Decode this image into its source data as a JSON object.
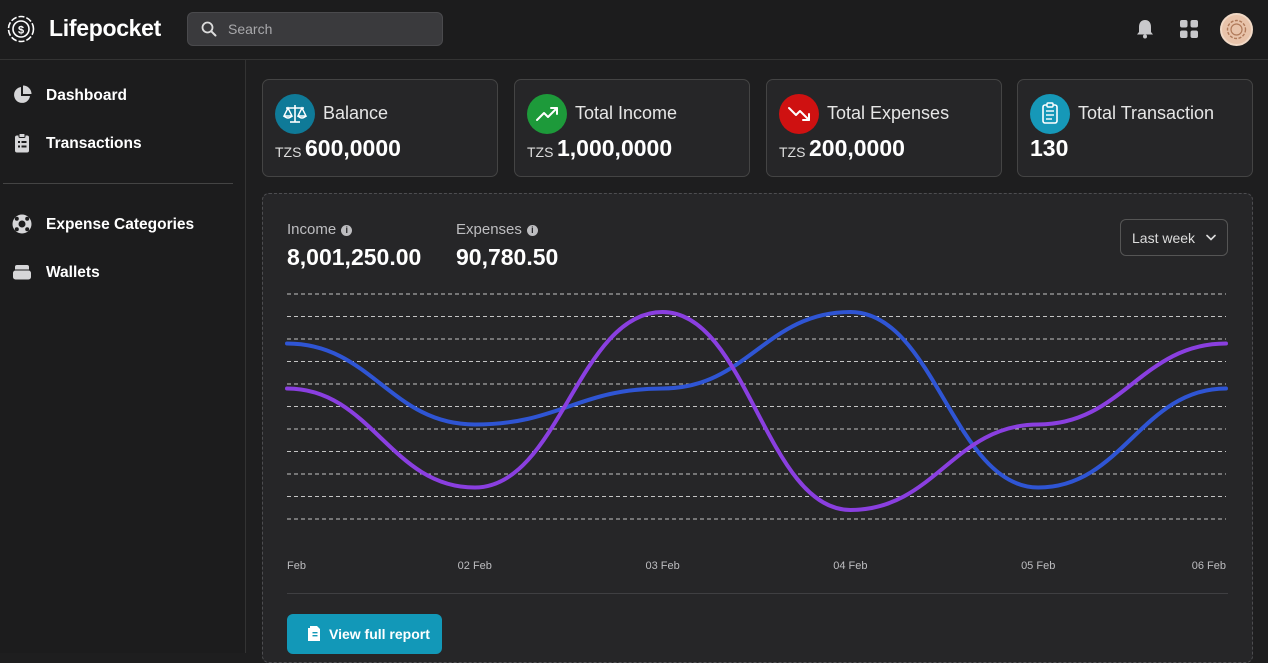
{
  "app": {
    "title": "Lifepocket"
  },
  "search": {
    "placeholder": "Search"
  },
  "sidebar": {
    "items": [
      {
        "label": "Dashboard",
        "icon": "pie-chart-icon"
      },
      {
        "label": "Transactions",
        "icon": "clipboard-list-icon"
      },
      {
        "label": "Expense Categories",
        "icon": "life-ring-icon"
      },
      {
        "label": "Wallets",
        "icon": "wallet-icon"
      }
    ]
  },
  "cards": [
    {
      "title": "Balance",
      "currency": "TZS",
      "value": "600,0000",
      "icon": "scale-icon",
      "color": "#0f7a98"
    },
    {
      "title": "Total Income",
      "currency": "TZS",
      "value": "1,000,0000",
      "icon": "trending-up-icon",
      "color": "#1d9a3a"
    },
    {
      "title": "Total Expenses",
      "currency": "TZS",
      "value": "200,0000",
      "icon": "trending-down-icon",
      "color": "#cf1111"
    },
    {
      "title": "Total Transaction",
      "currency": "",
      "value": "130",
      "icon": "clipboard-icon",
      "color": "#1698b8"
    }
  ],
  "summary": {
    "income_label": "Income",
    "income_value": "8,001,250.00",
    "expenses_label": "Expenses",
    "expenses_value": "90,780.50",
    "range": "Last week"
  },
  "chart_data": {
    "type": "line",
    "x": [
      "Feb",
      "02 Feb",
      "03 Feb",
      "04 Feb",
      "05 Feb",
      "06 Feb"
    ],
    "series": [
      {
        "color": "#2f55d4",
        "values": [
          0.78,
          0.42,
          0.58,
          0.92,
          0.14,
          0.58
        ]
      },
      {
        "color": "#8a3fe0",
        "values": [
          0.58,
          0.14,
          0.92,
          0.04,
          0.42,
          0.78
        ]
      }
    ],
    "ylim": [
      0,
      1
    ],
    "grid": true,
    "grid_style": "dashed"
  },
  "footer": {
    "report_label": "View full report"
  },
  "colors": {
    "accent": "#1298b8",
    "income_line": "#2f55d4",
    "expense_line": "#8a3fe0"
  }
}
